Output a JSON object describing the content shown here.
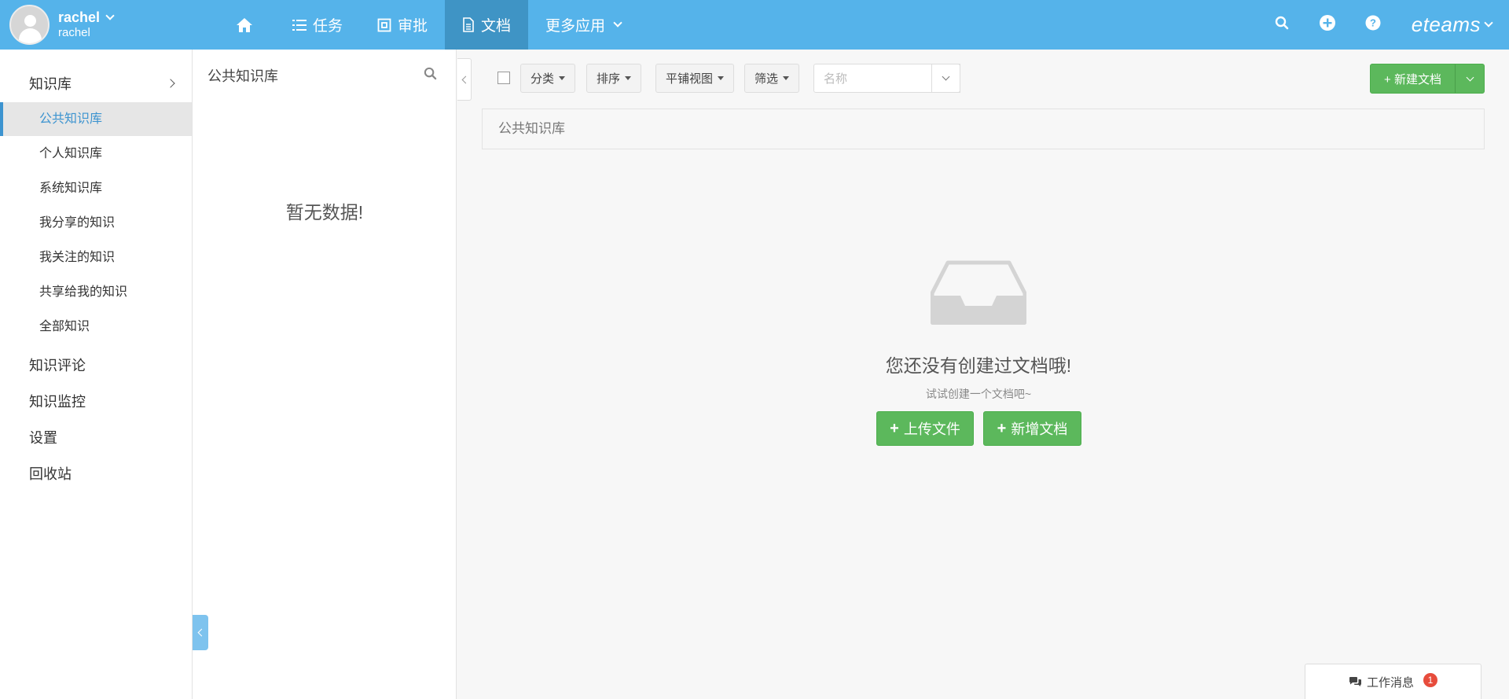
{
  "user": {
    "name": "rachel",
    "sub": "rachel"
  },
  "nav": [
    {
      "label": "",
      "icon": "home-icon"
    },
    {
      "label": "任务",
      "icon": "list-icon"
    },
    {
      "label": "审批",
      "icon": "approval-icon"
    },
    {
      "label": "文档",
      "icon": "document-icon",
      "active": true
    },
    {
      "label": "更多应用",
      "icon": "chevron-down-icon"
    }
  ],
  "brand": "eteams",
  "sidebar": {
    "knowledge_base": "知识库",
    "items": [
      {
        "label": "公共知识库",
        "active": true
      },
      {
        "label": "个人知识库"
      },
      {
        "label": "系统知识库"
      },
      {
        "label": "我分享的知识"
      },
      {
        "label": "我关注的知识"
      },
      {
        "label": "共享给我的知识"
      },
      {
        "label": "全部知识"
      }
    ],
    "sections": [
      "知识评论",
      "知识监控",
      "设置",
      "回收站"
    ]
  },
  "middle": {
    "title": "公共知识库",
    "empty": "暂无数据!"
  },
  "toolbar": {
    "category": "分类",
    "sort": "排序",
    "view": "平铺视图",
    "filter": "筛选",
    "search_placeholder": "名称",
    "new_doc": "+ 新建文档"
  },
  "breadcrumb": "公共知识库",
  "empty_state": {
    "title": "您还没有创建过文档哦!",
    "subtitle": "试试创建一个文档吧~",
    "upload_button": "上传文件",
    "add_button": "新增文档"
  },
  "work_message": {
    "label": "工作消息",
    "count": "1"
  },
  "colors": {
    "header": "#55b3ea",
    "active_nav": "#3f94c5",
    "green": "#5cb85c",
    "link_blue": "#3d94d0"
  }
}
